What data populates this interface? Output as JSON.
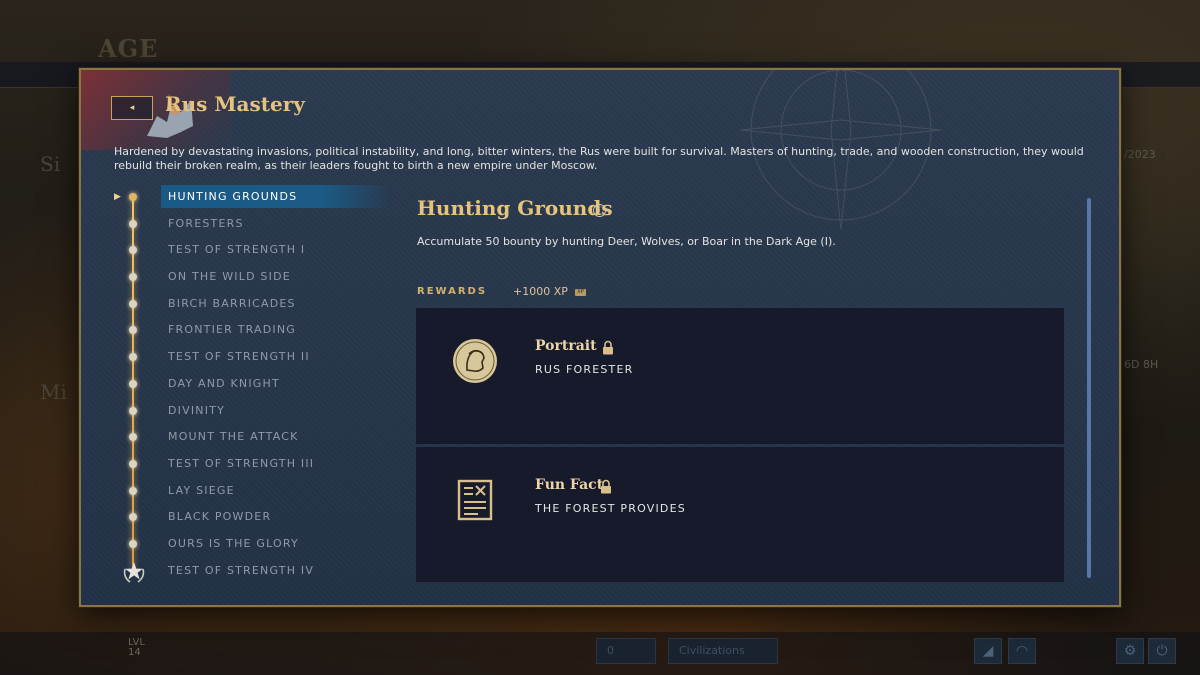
{
  "background": {
    "age_title": "AGE",
    "left_text_1": "Si",
    "left_text_2": "Mi",
    "date_fragment": "/2023",
    "timer_fragment": "6D 8H",
    "level_label": "LVL",
    "level_value": "14",
    "currency_value": "0",
    "menu_pill": "Civilizations"
  },
  "modal": {
    "back_label": "◂",
    "title": "Rus Mastery",
    "description": "Hardened by devastating invasions, political instability, and long, bitter winters, the Rus were built for survival. Masters of hunting, trade, and wooden construction, they would rebuild their broken realm, as their leaders fought to birth a new empire under Moscow."
  },
  "tiers": [
    {
      "label": "HUNTING GROUNDS",
      "active": true
    },
    {
      "label": "FORESTERS"
    },
    {
      "label": "TEST OF STRENGTH I"
    },
    {
      "label": "ON THE WILD SIDE"
    },
    {
      "label": "BIRCH BARRICADES"
    },
    {
      "label": "FRONTIER TRADING"
    },
    {
      "label": "TEST OF STRENGTH II"
    },
    {
      "label": "DAY AND KNIGHT"
    },
    {
      "label": "DIVINITY"
    },
    {
      "label": "MOUNT THE ATTACK"
    },
    {
      "label": "TEST OF STRENGTH III"
    },
    {
      "label": "LAY SIEGE"
    },
    {
      "label": "BLACK POWDER"
    },
    {
      "label": "OURS IS THE GLORY"
    },
    {
      "label": "TEST OF STRENGTH IV",
      "final": true
    }
  ],
  "detail": {
    "title": "Hunting Grounds",
    "info_icon": "ⓘ",
    "description": "Accumulate 50 bounty by hunting Deer, Wolves, or Boar in the Dark Age (I).",
    "rewards_label": "REWARDS",
    "xp": "+1000 XP",
    "xp_tag": "XP"
  },
  "rewards": [
    {
      "name": "Portrait",
      "subtitle": "RUS FORESTER",
      "icon": "portrait-icon",
      "locked": true
    },
    {
      "name": "Fun Fact",
      "subtitle": "THE FOREST PROVIDES",
      "icon": "scroll-document-icon",
      "locked": true
    }
  ],
  "colors": {
    "accent_gold": "#e6c37d",
    "panel_blue": "#26354a",
    "active_blue": "#1b5b86",
    "card_dark": "#161a2a"
  }
}
